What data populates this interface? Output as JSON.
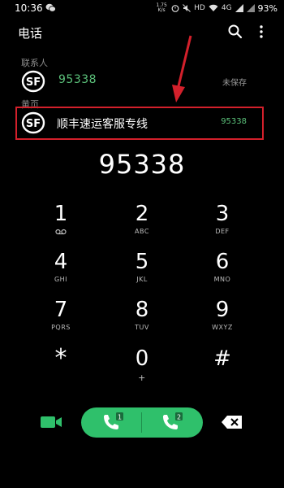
{
  "status_bar": {
    "time": "10:36",
    "speed_value": "1.75",
    "speed_unit": "K/s",
    "network": "HD",
    "signal_type": "4G",
    "battery": "93%"
  },
  "app_bar": {
    "title": "电话",
    "search_icon": "search-icon",
    "more_icon": "more-vert-icon"
  },
  "results": {
    "contacts_label": "联系人",
    "contact": {
      "number": "95338",
      "status": "未保存"
    },
    "yellow_pages_label": "黄页",
    "yellow_page": {
      "name": "顺丰速运客服专线",
      "number": "95338"
    }
  },
  "dialed_number": "95338",
  "keypad": [
    {
      "num": "1",
      "sub": ""
    },
    {
      "num": "2",
      "sub": "ABC"
    },
    {
      "num": "3",
      "sub": "DEF"
    },
    {
      "num": "4",
      "sub": "GHI"
    },
    {
      "num": "5",
      "sub": "JKL"
    },
    {
      "num": "6",
      "sub": "MNO"
    },
    {
      "num": "7",
      "sub": "PQRS"
    },
    {
      "num": "8",
      "sub": "TUV"
    },
    {
      "num": "9",
      "sub": "WXYZ"
    },
    {
      "num": "*",
      "sub": ""
    },
    {
      "num": "0",
      "sub": "+"
    },
    {
      "num": "#",
      "sub": ""
    }
  ],
  "bottom_bar": {
    "sim1_badge": "1",
    "sim2_badge": "2",
    "colors": {
      "call_green": "#2fc06b",
      "accent_green": "#5bc17a",
      "highlight_red": "#d3202b"
    }
  }
}
